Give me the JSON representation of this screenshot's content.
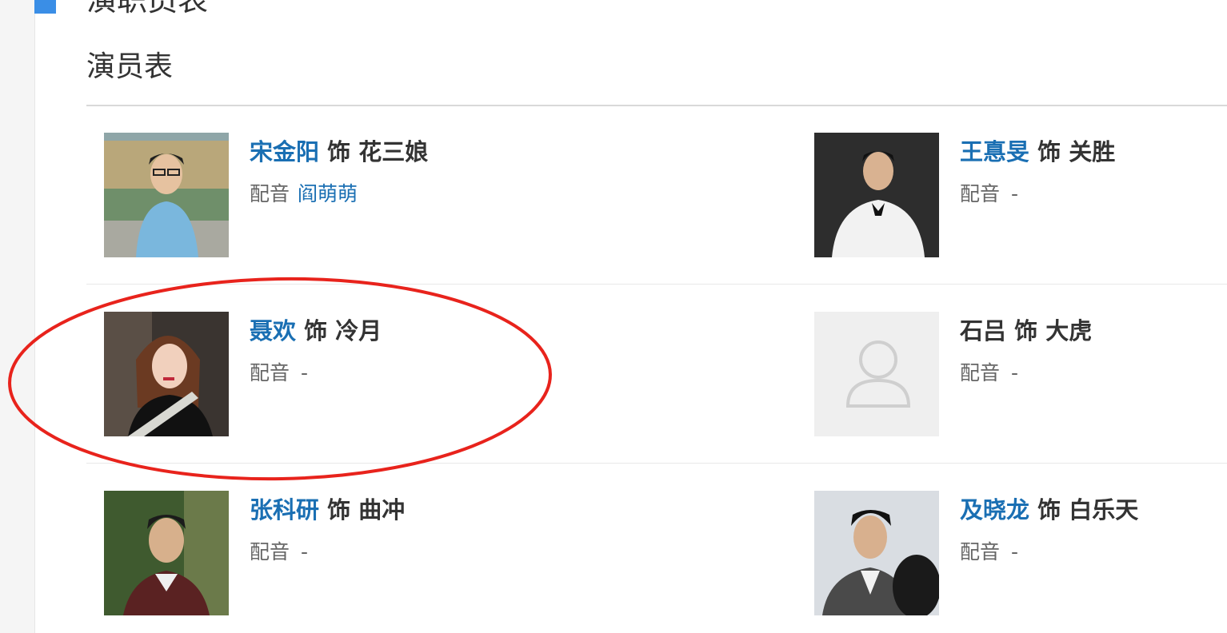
{
  "section": {
    "title": "演职员表"
  },
  "subsection": {
    "title": "演员表"
  },
  "labels": {
    "role_connector": "饰",
    "voice_label": "配音"
  },
  "cast": [
    {
      "actor": "宋金阳",
      "role": "花三娘",
      "voice_actor": "阎萌萌",
      "actor_linked": true
    },
    {
      "actor": "王惪旻",
      "role": "关胜",
      "voice_actor": "-",
      "actor_linked": true
    },
    {
      "actor": "聂欢",
      "role": "冷月",
      "voice_actor": "-",
      "actor_linked": true
    },
    {
      "actor": "石吕",
      "role": "大虎",
      "voice_actor": "-",
      "actor_linked": false
    },
    {
      "actor": "张科研",
      "role": "曲冲",
      "voice_actor": "-",
      "actor_linked": true
    },
    {
      "actor": "及晓龙",
      "role": "白乐天",
      "voice_actor": "-",
      "actor_linked": true
    }
  ],
  "annotation": {
    "shape": "ellipse",
    "color": "#e8231c",
    "target": "聂欢 饰 冷月"
  },
  "colors": {
    "link": "#1a6fb3",
    "text": "#333333",
    "muted": "#666666",
    "accent": "#3a8ee6"
  }
}
